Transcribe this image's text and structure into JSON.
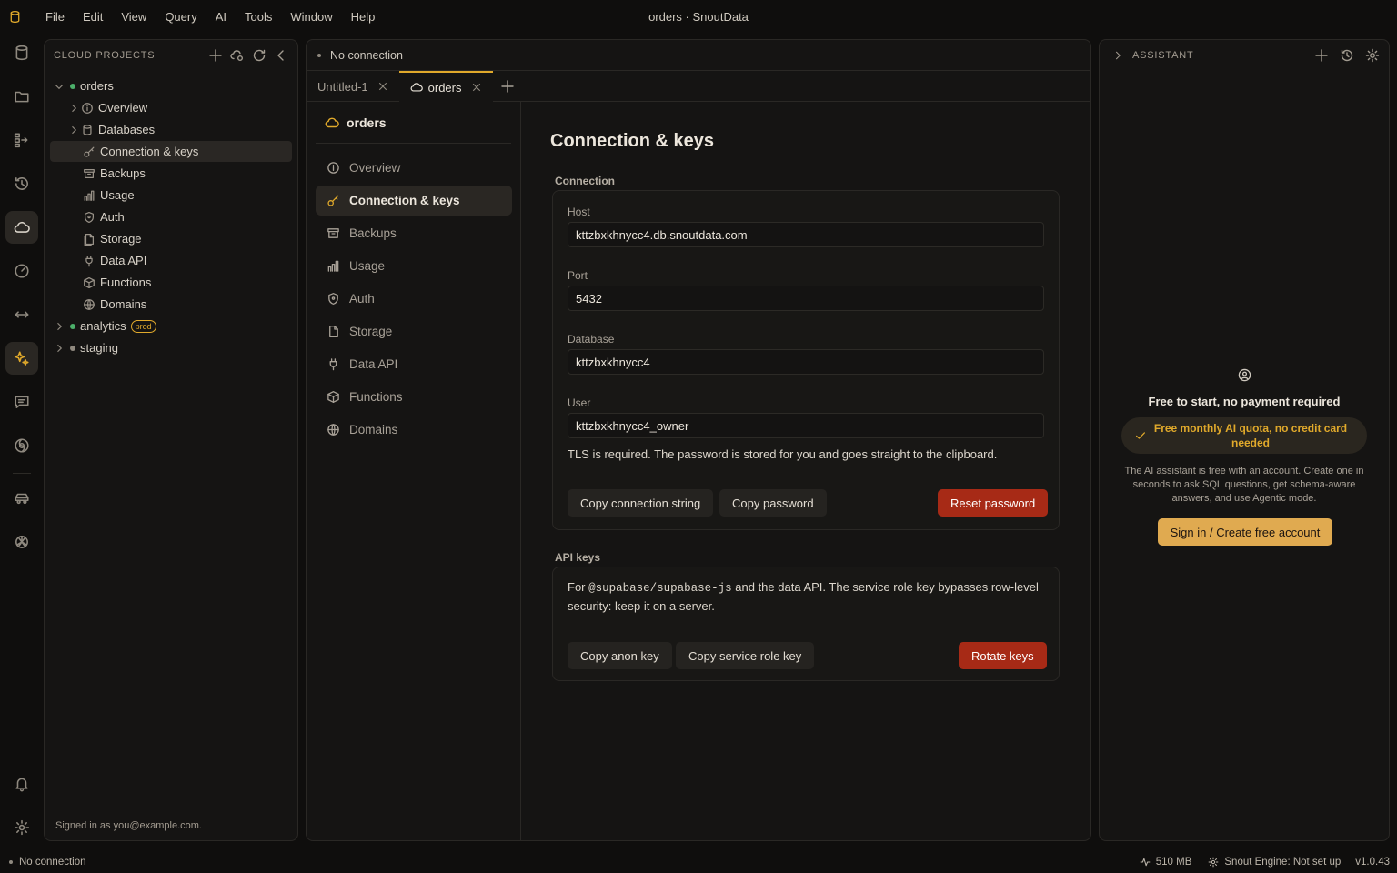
{
  "app": {
    "window_title": "orders · SnoutData",
    "menu": [
      "File",
      "Edit",
      "View",
      "Query",
      "AI",
      "Tools",
      "Window",
      "Help"
    ]
  },
  "colors": {
    "accent": "#e0a92b",
    "danger": "#a72a16",
    "connected": "#4caf6a",
    "idle": "#8f897f"
  },
  "activity_bar": [
    "database-icon",
    "folder-icon",
    "schema-icon",
    "history-icon",
    "cloud-icon",
    "gauge-icon",
    "transfer-icon",
    "sparkle-icon",
    "chat-icon",
    "swirl-icon",
    "car-icon",
    "openai-icon",
    "bell-icon",
    "gear-icon"
  ],
  "left_panel": {
    "title": "CLOUD PROJECTS",
    "signed_in": "Signed in as you@example.com.",
    "projects": [
      {
        "name": "orders",
        "status": "connected",
        "expanded": true,
        "children": [
          {
            "label": "Overview",
            "icon": "info-icon",
            "expandable": true
          },
          {
            "label": "Databases",
            "icon": "database-icon",
            "expandable": true
          },
          {
            "label": "Connection & keys",
            "icon": "key-icon",
            "selected": true
          },
          {
            "label": "Backups",
            "icon": "archive-icon"
          },
          {
            "label": "Usage",
            "icon": "bar-chart-icon"
          },
          {
            "label": "Auth",
            "icon": "shield-icon"
          },
          {
            "label": "Storage",
            "icon": "file-icon"
          },
          {
            "label": "Data API",
            "icon": "plug-icon"
          },
          {
            "label": "Functions",
            "icon": "box-icon"
          },
          {
            "label": "Domains",
            "icon": "globe-icon"
          }
        ]
      },
      {
        "name": "analytics",
        "status": "connected",
        "badge": "prod"
      },
      {
        "name": "staging",
        "status": "idle"
      }
    ]
  },
  "center": {
    "connection_status": "No connection",
    "tabs": [
      {
        "label": "Untitled-1"
      },
      {
        "label": "orders",
        "active": true
      }
    ],
    "subnav": {
      "title": "orders",
      "items": [
        "Overview",
        "Connection & keys",
        "Backups",
        "Usage",
        "Auth",
        "Storage",
        "Data API",
        "Functions",
        "Domains"
      ],
      "selected": "Connection & keys"
    },
    "page_title": "Connection & keys",
    "connection": {
      "section": "Connection",
      "fields": [
        {
          "label": "Host",
          "value": "kttzbxkhnycc4.db.snoutdata.com"
        },
        {
          "label": "Port",
          "value": "5432"
        },
        {
          "label": "Database",
          "value": "kttzbxkhnycc4"
        },
        {
          "label": "User",
          "value": "kttzbxkhnycc4_owner"
        }
      ],
      "note": "TLS is required. The password is stored for you and goes straight to the clipboard.",
      "copy_conn": "Copy connection string",
      "copy_pw": "Copy password",
      "reset_pw": "Reset password"
    },
    "api": {
      "section": "API keys",
      "note_pre": "For ",
      "note_code": "@supabase/supabase-js",
      "note_post": " and the data API. The service role key bypasses row-level security: keep it on a server.",
      "copy_anon": "Copy anon key",
      "copy_service": "Copy service role key",
      "rotate": "Rotate keys"
    }
  },
  "assistant": {
    "title": "ASSISTANT",
    "headline": "Free to start, no payment required",
    "quota": "Free monthly AI quota, no credit card needed",
    "desc": "The AI assistant is free with an account. Create one in seconds to ask SQL questions, get schema-aware answers, and use Agentic mode.",
    "signin": "Sign in / Create free account"
  },
  "status": {
    "connection": "No connection",
    "memory": "510 MB",
    "engine": "Snout Engine: Not set up",
    "version": "v1.0.43"
  }
}
